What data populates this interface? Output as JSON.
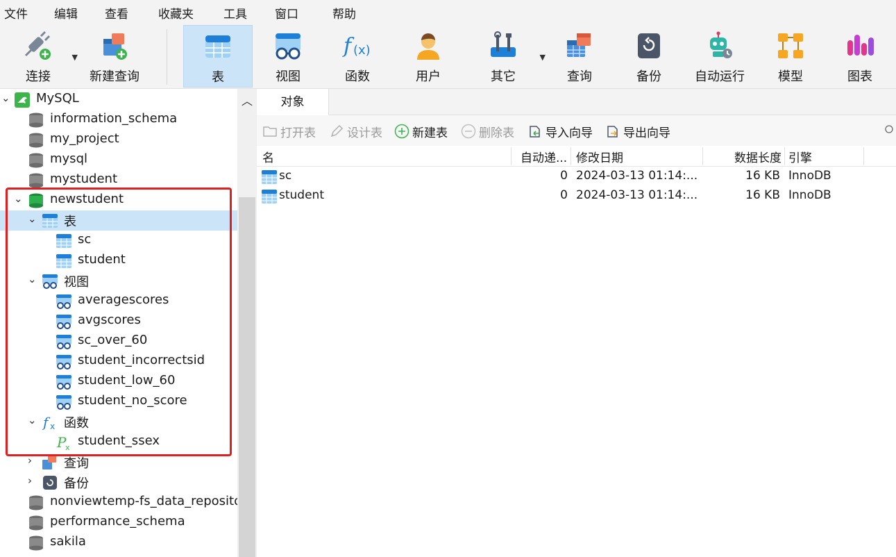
{
  "menu": [
    "文件",
    "编辑",
    "查看",
    "收藏夹",
    "工具",
    "窗口",
    "帮助"
  ],
  "toolbar": {
    "connect": "连接",
    "new_query": "新建查询",
    "table": "表",
    "view": "视图",
    "function": "函数",
    "user": "用户",
    "other": "其它",
    "query": "查询",
    "backup": "备份",
    "auto_run": "自动运行",
    "model": "模型",
    "chart": "图表"
  },
  "tree": {
    "root": "MySQL",
    "databases_top": [
      "information_schema",
      "my_project",
      "mysql",
      "mystudent"
    ],
    "open_db": "newstudent",
    "tables_group": "表",
    "tables": [
      "sc",
      "student"
    ],
    "views_group": "视图",
    "views": [
      "averagescores",
      "avgscores",
      "sc_over_60",
      "student_incorrectsid",
      "student_low_60",
      "student_no_score"
    ],
    "functions_group": "函数",
    "functions": [
      "student_ssex"
    ],
    "queries_group": "查询",
    "backups_group": "备份",
    "databases_bottom": [
      "nonviewtemp-fs_data_repositor",
      "performance_schema",
      "sakila"
    ]
  },
  "main": {
    "tab": "对象",
    "actions": {
      "open_table": "打开表",
      "design_table": "设计表",
      "new_table": "新建表",
      "delete_table": "删除表",
      "import_wizard": "导入向导",
      "export_wizard": "导出向导"
    },
    "columns": [
      "名",
      "自动递...",
      "修改日期",
      "数据长度",
      "引擎"
    ],
    "rows": [
      {
        "name": "sc",
        "auto_inc": "0",
        "modified": "2024-03-13 01:14:...",
        "size": "16 KB",
        "engine": "InnoDB"
      },
      {
        "name": "student",
        "auto_inc": "0",
        "modified": "2024-03-13 01:14:...",
        "size": "16 KB",
        "engine": "InnoDB"
      }
    ]
  }
}
